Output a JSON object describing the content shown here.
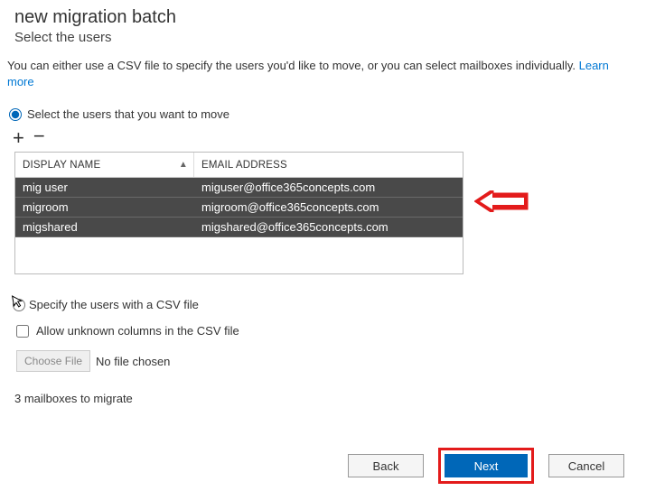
{
  "header": {
    "title": "new migration batch",
    "subtitle": "Select the users"
  },
  "description": {
    "text": "You can either use a CSV file to specify the users you'd like to move, or you can select mailboxes individually.",
    "learn_more": "Learn more"
  },
  "options": {
    "select_users_label": "Select the users that you want to move",
    "specify_csv_label": "Specify the users with a CSV file",
    "allow_unknown_label": "Allow unknown columns in the CSV file"
  },
  "grid": {
    "headers": {
      "display_name": "DISPLAY NAME",
      "email": "EMAIL ADDRESS"
    },
    "rows": [
      {
        "name": "mig user",
        "email": "miguser@office365concepts.com"
      },
      {
        "name": "migroom",
        "email": "migroom@office365concepts.com"
      },
      {
        "name": "migshared",
        "email": "migshared@office365concepts.com"
      }
    ]
  },
  "file": {
    "choose": "Choose File",
    "status": "No file chosen"
  },
  "summary": {
    "count_text": "3 mailboxes to migrate"
  },
  "buttons": {
    "back": "Back",
    "next": "Next",
    "cancel": "Cancel"
  }
}
